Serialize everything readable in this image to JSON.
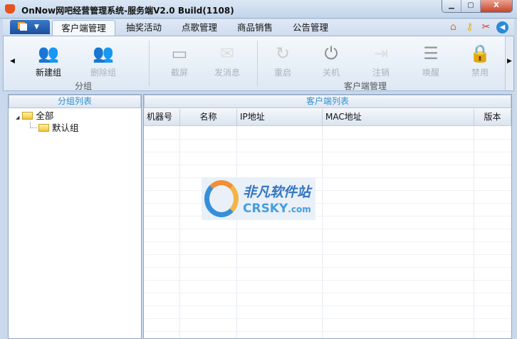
{
  "window": {
    "title": "OnNow网吧经营管理系统-服务端V2.0 Build(1108)",
    "minimize": "▁",
    "maximize": "▢",
    "close": "X"
  },
  "tabs": [
    {
      "label": "客户端管理"
    },
    {
      "label": "抽奖活动"
    },
    {
      "label": "点歌管理"
    },
    {
      "label": "商品销售"
    },
    {
      "label": "公告管理"
    }
  ],
  "app_menu": "▼",
  "quick_icons": [
    "home-icon",
    "key-icon",
    "tools-icon",
    "sound-icon"
  ],
  "ribbon": {
    "groups": [
      {
        "label": "分组"
      },
      {
        "label": "客户端管理"
      }
    ],
    "buttons": [
      {
        "label": "新建组",
        "icon": "👥"
      },
      {
        "label": "删除组",
        "icon": "👥"
      },
      {
        "label": "截屏",
        "icon": "▭"
      },
      {
        "label": "发消息",
        "icon": "✉"
      },
      {
        "label": "重启",
        "icon": "↻"
      },
      {
        "label": "关机",
        "icon": "⏻"
      },
      {
        "label": "注销",
        "icon": "⇥"
      },
      {
        "label": "唤醒",
        "icon": "☰"
      },
      {
        "label": "禁用",
        "icon": "🔒"
      }
    ],
    "scroll_left": "◀",
    "scroll_right": "▶"
  },
  "left_panel": {
    "title": "分组列表",
    "tree": [
      {
        "label": "全部",
        "expander": "◢"
      },
      {
        "label": "默认组"
      }
    ]
  },
  "right_panel": {
    "title": "客户端列表",
    "columns": [
      "机器号",
      "名称",
      "IP地址",
      "MAC地址",
      "版本"
    ]
  },
  "watermark": {
    "cn": "非凡软件站",
    "en": "CRSKY",
    ".com": ".com"
  }
}
